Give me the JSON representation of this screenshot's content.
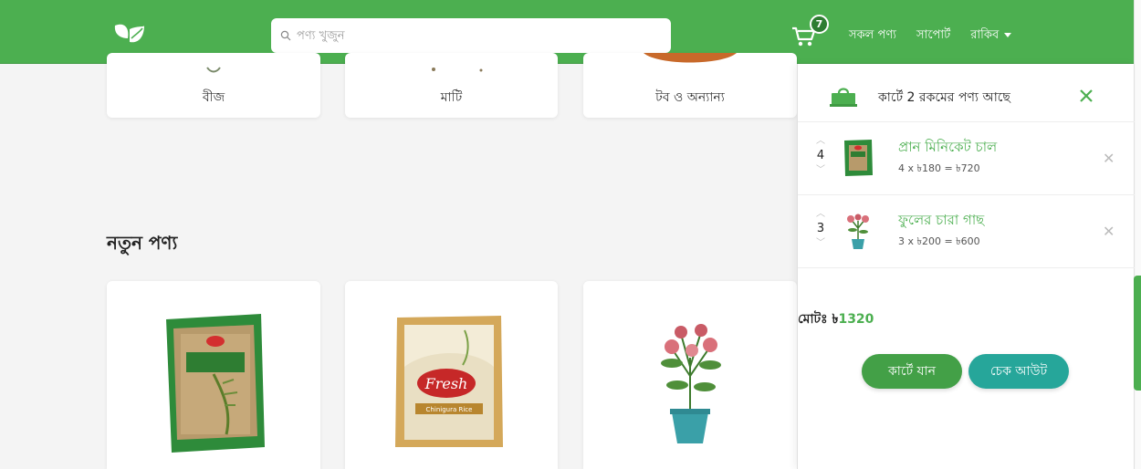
{
  "header": {
    "search_placeholder": "পণ্য খুজুন",
    "cart_count": "7",
    "nav": [
      "সকল পণ্য",
      "সাপোর্ট",
      "রাকিব"
    ]
  },
  "categories": [
    "বীজ",
    "মাটি",
    "টব ও অন্যান্য"
  ],
  "new_products_title": "নতুন পণ্য",
  "cart": {
    "title": "কার্টে 2 রকমের পণ্য আছে",
    "items": [
      {
        "name": "প্রান মিনিকেট চাল",
        "qty": "4",
        "price_line": "4 x ৳180 = ৳720"
      },
      {
        "name": "ফুলের চারা গাছ",
        "qty": "3",
        "price_line": "3 x ৳200 = ৳600"
      }
    ],
    "total_label": "মোটঃ ৳",
    "total_value": "1320",
    "go_to_cart": "কার্টে যান",
    "checkout": "চেক আউট"
  },
  "colors": {
    "brand_green": "#4caf50",
    "teal": "#26a69a"
  }
}
